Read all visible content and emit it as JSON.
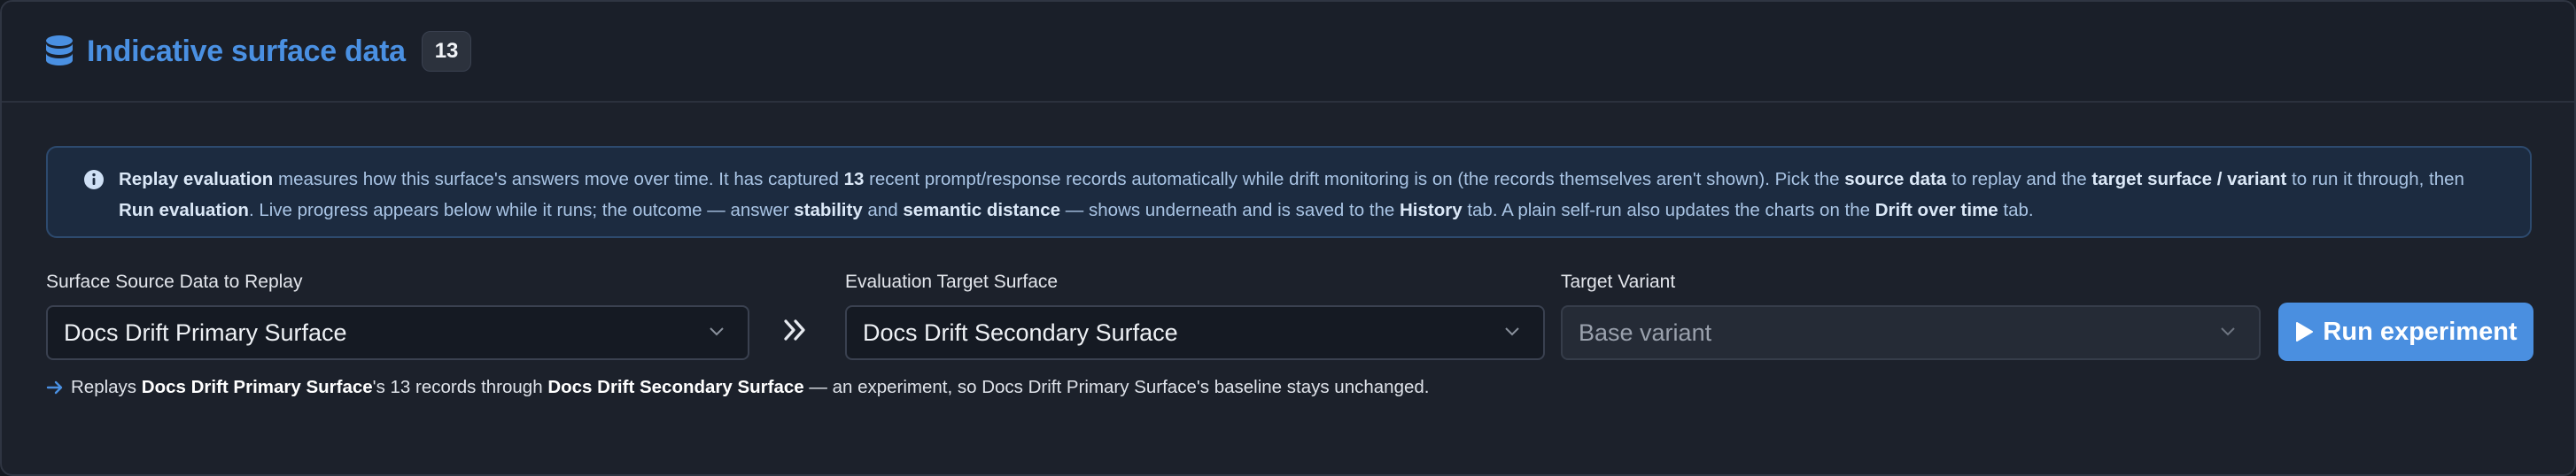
{
  "header": {
    "icon": "database-icon",
    "title": "Indicative surface data",
    "count": "13"
  },
  "info": {
    "icon": "info-circle-icon",
    "segments": [
      {
        "t": "Replay evaluation",
        "b": true
      },
      {
        "t": " measures how this surface's answers move over time. It has captured ",
        "b": false
      },
      {
        "t": "13",
        "b": true
      },
      {
        "t": " recent prompt/response records automatically while drift monitoring is on (the records themselves aren't shown). Pick the ",
        "b": false
      },
      {
        "t": "source data",
        "b": true
      },
      {
        "t": " to replay and the ",
        "b": false
      },
      {
        "t": "target surface / variant",
        "b": true
      },
      {
        "t": " to run it through, then ",
        "b": false
      },
      {
        "t": "Run evaluation",
        "b": true
      },
      {
        "t": ". Live progress appears below while it runs; the outcome — answer ",
        "b": false
      },
      {
        "t": "stability",
        "b": true
      },
      {
        "t": " and ",
        "b": false
      },
      {
        "t": "semantic distance",
        "b": true
      },
      {
        "t": " — shows underneath and is saved to the ",
        "b": false
      },
      {
        "t": "History",
        "b": true
      },
      {
        "t": " tab. A plain self-run also updates the charts on the ",
        "b": false
      },
      {
        "t": "Drift over time",
        "b": true
      },
      {
        "t": " tab.",
        "b": false
      }
    ]
  },
  "form": {
    "source_label": "Surface Source Data to Replay",
    "source_value": "Docs Drift Primary Surface",
    "target_label": "Evaluation Target Surface",
    "target_value": "Docs Drift Secondary Surface",
    "variant_label": "Target Variant",
    "variant_value": "Base variant",
    "run_label": "Run experiment"
  },
  "note": {
    "segments": [
      {
        "t": "Replays ",
        "b": false
      },
      {
        "t": "Docs Drift Primary Surface",
        "b": true
      },
      {
        "t": "'s 13 records through ",
        "b": false
      },
      {
        "t": "Docs Drift Secondary Surface",
        "b": true
      },
      {
        "t": " — an experiment, so Docs Drift Primary Surface's baseline stays unchanged.",
        "b": false
      }
    ]
  },
  "colors": {
    "accent": "#4a90e2",
    "panel_bg": "#1c212b",
    "info_bg": "#1c2b40",
    "button_bg": "#4a8fe0"
  }
}
